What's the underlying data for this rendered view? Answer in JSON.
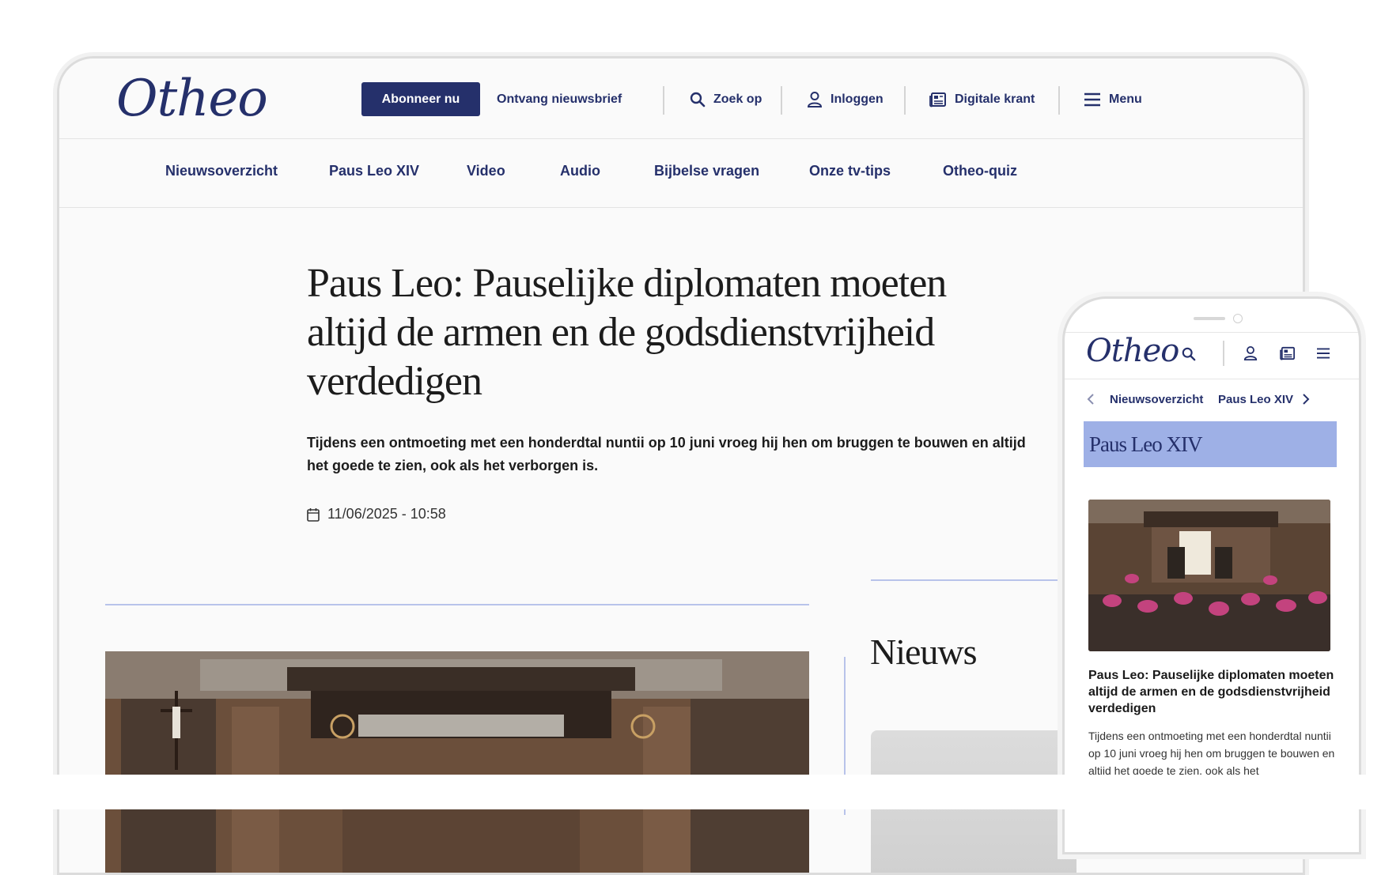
{
  "desktop": {
    "logo": "Otheo",
    "topbar": {
      "subscribe": "Abonneer nu",
      "newsletter": "Ontvang nieuwsbrief",
      "search": "Zoek op",
      "login": "Inloggen",
      "digital": "Digitale krant",
      "menu": "Menu"
    },
    "nav": [
      "Nieuwsoverzicht",
      "Paus Leo XIV",
      "Video",
      "Audio",
      "Bijbelse vragen",
      "Onze tv-tips",
      "Otheo-quiz"
    ],
    "article": {
      "headline": "Paus Leo: Pauselijke diplomaten moeten altijd de armen en de godsdienstvrijheid verdedigen",
      "lead": "Tijdens een ontmoeting met een honderdtal nuntii op 10 juni vroeg hij hen om bruggen te bouwen en altijd het goede te zien, ook als het verborgen is.",
      "date": "11/06/2025 - 10:58"
    },
    "sidebar_title": "Nieuws"
  },
  "mobile": {
    "logo": "Otheo",
    "nav": [
      "Nieuwsoverzicht",
      "Paus Leo XIV"
    ],
    "banner": "Paus Leo XIV",
    "title": "Paus Leo: Pauselijke diplomaten moeten altijd de armen en de godsdienstvrijheid verdedigen",
    "lead": "Tijdens een ontmoeting met een honderdtal nuntii op 10 juni vroeg hij hen om bruggen te bouwen en altijd het goede te zien, ook als het"
  },
  "colors": {
    "brand": "#25306b",
    "accent_light": "#9eb0e6",
    "rule": "#b8c3ea"
  }
}
